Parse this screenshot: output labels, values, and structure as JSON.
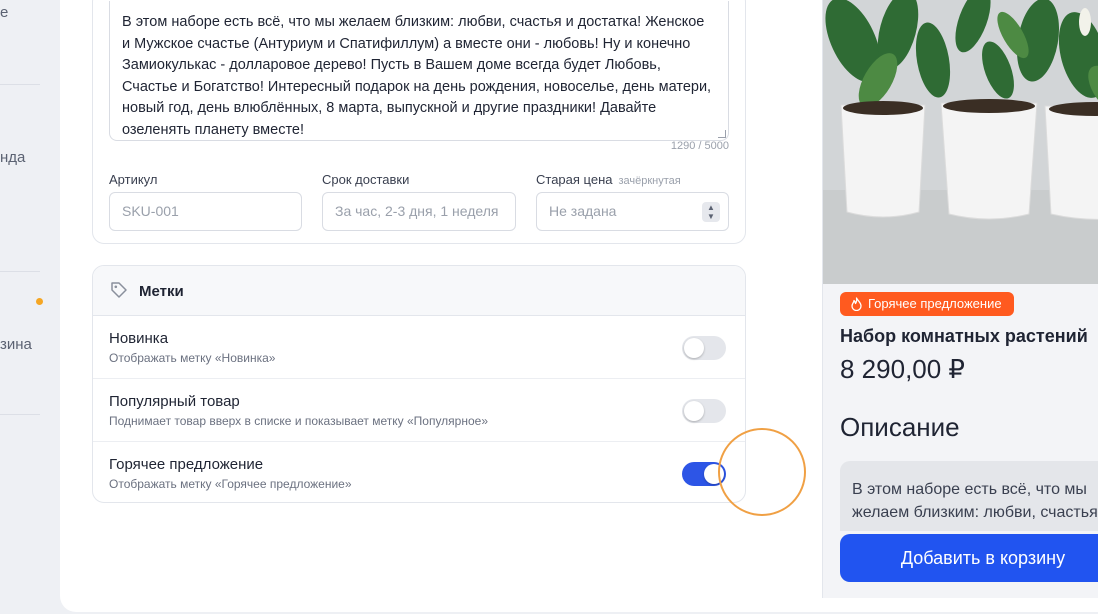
{
  "sidebar": {
    "items": [
      {
        "label": "е"
      },
      {
        "label": "нда"
      },
      {
        "label": "зина"
      }
    ]
  },
  "description": {
    "text": "В этом наборе есть всё, что мы желаем близким: любви, счастья и достатка! Женское и Мужское счастье (Антуриум и Спатифиллум) а вместе они - любовь! Ну и конечно Замиокулькас - долларовое дерево! Пусть в Вашем доме всегда будет Любовь, Счастье и Богатство! Интересный подарок на день рождения, новоселье, день матери, новый год, день влюблённых, 8 марта, выпускной и другие праздники! Давайте озеленять планету вместе!",
    "counter": "1290 / 5000"
  },
  "fields": {
    "sku": {
      "label": "Артикул",
      "placeholder": "SKU-001"
    },
    "delivery": {
      "label": "Срок доставки",
      "placeholder": "За час, 2-3 дня, 1 неделя"
    },
    "old_price": {
      "label": "Старая цена",
      "hint": "зачёркнутая",
      "placeholder": "Не задана"
    }
  },
  "tags": {
    "title": "Метки",
    "items": [
      {
        "name": "Новинка",
        "sub": "Отображать метку «Новинка»",
        "enabled": false
      },
      {
        "name": "Популярный товар",
        "sub": "Поднимает товар вверх в списке и показывает метку «Популярное»",
        "enabled": false
      },
      {
        "name": "Горячее предложение",
        "sub": "Отображать метку «Горячее предложение»",
        "enabled": true
      }
    ]
  },
  "preview": {
    "badge": "Горячее предложение",
    "name": "Набор комнатных растений",
    "price": "8 290,00 ₽",
    "desc_title": "Описание",
    "desc_text": "В этом наборе есть всё, что мы желаем близким: любви, счастья",
    "cart_button": "Добавить в корзину"
  },
  "colors": {
    "accent": "#2d55e6",
    "hot_badge": "#ff5a1f",
    "highlight": "#f0a044",
    "cart_button": "#2154f0"
  }
}
